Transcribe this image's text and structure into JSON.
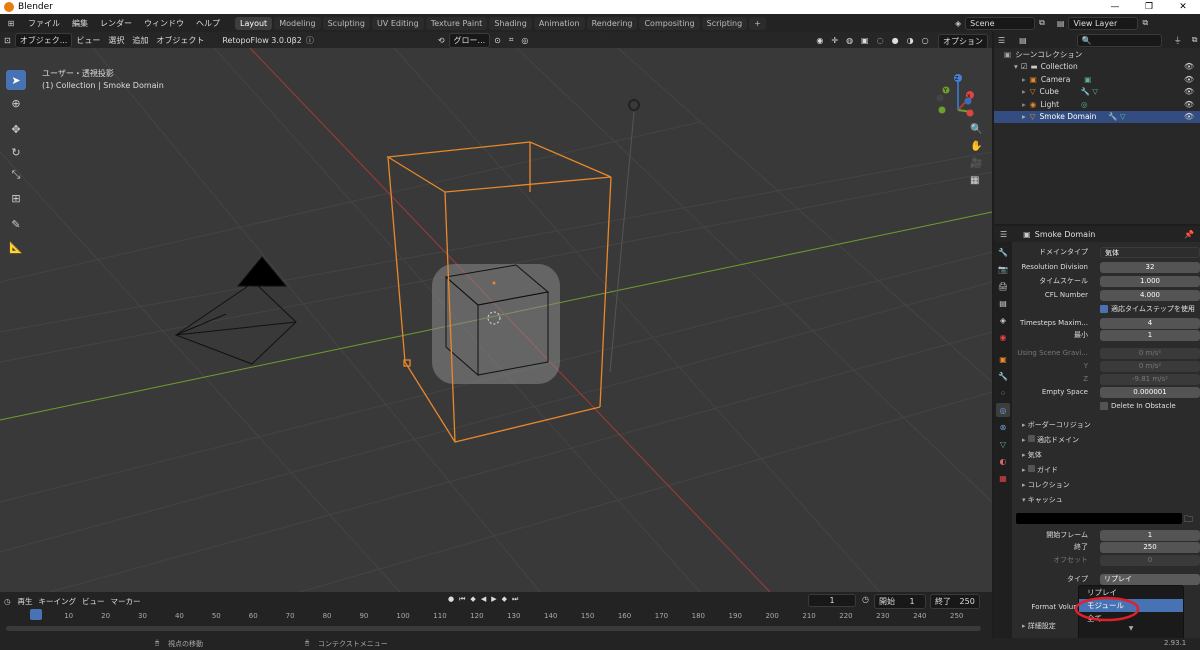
{
  "window": {
    "title": "Blender",
    "controls": [
      "—",
      "❐",
      "✕"
    ]
  },
  "menu": [
    "ファイル",
    "編集",
    "レンダー",
    "ウィンドウ",
    "ヘルプ"
  ],
  "workspaces": [
    "Layout",
    "Modeling",
    "Sculpting",
    "UV Editing",
    "Texture Paint",
    "Shading",
    "Animation",
    "Rendering",
    "Compositing",
    "Scripting",
    "+"
  ],
  "scene": {
    "name": "Scene",
    "view_layer": "View Layer"
  },
  "viewport": {
    "mode": "オブジェク...",
    "header_menu": [
      "ビュー",
      "選択",
      "追加",
      "オブジェクト"
    ],
    "addon": "RetopoFlow 3.0.0β2",
    "transform": "グロー...",
    "options": "オプション",
    "info_line1": "ユーザー・透視投影",
    "info_line2": "(1) Collection | Smoke Domain",
    "gizmo": {
      "x": "X",
      "y": "Y",
      "z": "Z"
    }
  },
  "outliner": {
    "scene_collection": "シーンコレクション",
    "collection": "Collection",
    "items": [
      {
        "name": "Camera",
        "selected": false
      },
      {
        "name": "Cube",
        "selected": false
      },
      {
        "name": "Light",
        "selected": false
      },
      {
        "name": "Smoke Domain",
        "selected": true
      }
    ]
  },
  "properties": {
    "object_name": "Smoke Domain",
    "domain_type_label": "ドメインタイプ",
    "domain_type_value": "気体",
    "rows": [
      {
        "label": "Resolution Division",
        "value": "32"
      },
      {
        "label": "タイムスケール",
        "value": "1.000"
      },
      {
        "label": "CFL Number",
        "value": "4.000"
      }
    ],
    "adaptive_timestep": "適応タイムステップを使用",
    "timesteps_max_label": "Timesteps Maxim...",
    "timesteps_max_value": "4",
    "min_label": "最小",
    "min_value": "1",
    "gravity_label": "Using Scene Gravi...",
    "gravity": [
      {
        "axis": "",
        "value": "0 m/s²"
      },
      {
        "axis": "Y",
        "value": "0 m/s²"
      },
      {
        "axis": "Z",
        "value": "-9.81 m/s²"
      }
    ],
    "empty_space_label": "Empty Space",
    "empty_space_value": "0.000001",
    "delete_obstacle": "Delete In Obstacle",
    "sections": [
      "ボーダーコリジョン",
      "適応ドメイン",
      "気体",
      "ガイド",
      "コレクション",
      "キャッシュ"
    ],
    "cache": {
      "start_label": "開始フレーム",
      "start_value": "1",
      "end_label": "終了",
      "end_value": "250",
      "offset_label": "オフセット",
      "offset_value": "0",
      "type_label": "タイプ",
      "type_value": "リプレイ",
      "format_label": "Format Volumes",
      "details": "詳細設定"
    },
    "dropdown": [
      "リプレイ",
      "モジュール",
      "全て"
    ]
  },
  "timeline": {
    "menu": [
      "再生",
      "キーイング",
      "ビュー",
      "マーカー"
    ],
    "current_frame": "1",
    "start_label": "開始",
    "start": "1",
    "end_label": "終了",
    "end": "250",
    "ticks": [
      "1",
      "10",
      "20",
      "30",
      "40",
      "50",
      "60",
      "70",
      "80",
      "90",
      "100",
      "110",
      "120",
      "130",
      "140",
      "150",
      "160",
      "170",
      "180",
      "190",
      "200",
      "210",
      "220",
      "230",
      "240",
      "250"
    ]
  },
  "status": {
    "move_view": "視点の移動",
    "context_menu": "コンテクストメニュー",
    "version": "2.93.1"
  },
  "colors": {
    "accent": "#4772b3",
    "selection": "#e8882a",
    "x_axis": "#b33a3a",
    "y_axis": "#6e9f2e"
  }
}
